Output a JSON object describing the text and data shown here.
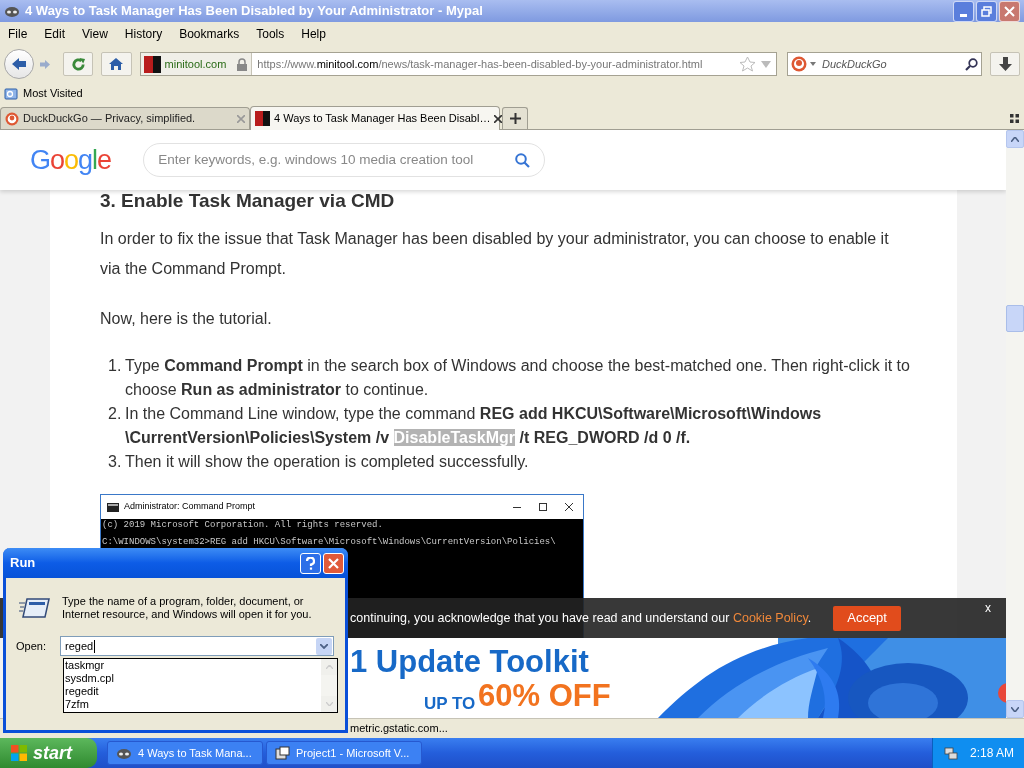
{
  "window": {
    "title": "4 Ways to Task Manager Has Been Disabled by Your Administrator - Mypal"
  },
  "menu": [
    "File",
    "Edit",
    "View",
    "History",
    "Bookmarks",
    "Tools",
    "Help"
  ],
  "navigation": {
    "site_identity": "minitool.com",
    "url": {
      "prefix": "https://www.",
      "domain": "minitool.com",
      "path": "/news/task-manager-has-been-disabled-by-your-administrator.html"
    },
    "search_placeholder": "DuckDuckGo"
  },
  "bookmarks": [
    "Most Visited"
  ],
  "tabs": [
    {
      "label": "DuckDuckGo — Privacy, simplified.",
      "selected": false
    },
    {
      "label": "4 Ways to Task Manager Has Been Disabl…",
      "selected": true
    }
  ],
  "page": {
    "header": {
      "logo": "Google",
      "search_placeholder": "Enter keywords, e.g. windows 10 media creation tool"
    },
    "article": {
      "heading": "3. Enable Task Manager via CMD",
      "paragraphs": [
        "In order to fix the issue that Task Manager has been disabled by your administrator, you can choose to enable it via the Command Prompt.",
        "Now, here is the tutorial."
      ],
      "steps": [
        {
          "number": "1.",
          "segments": [
            {
              "text": "Type ",
              "kind": "plain"
            },
            {
              "text": "Command Prompt",
              "kind": "bold"
            },
            {
              "text": " in the search box of Windows and choose the best-matched one. Then right-click it to choose ",
              "kind": "plain"
            },
            {
              "text": "Run as administrator",
              "kind": "bold"
            },
            {
              "text": " to continue.",
              "kind": "plain"
            }
          ]
        },
        {
          "number": "2.",
          "segments": [
            {
              "text": "In the Command Line window, type the command ",
              "kind": "plain"
            },
            {
              "text": "REG add HKCU\\Software\\Microsoft\\Windows",
              "kind": "bold"
            },
            {
              "text": "\\CurrentVersion\\Policies\\System /v ",
              "kind": "bold"
            },
            {
              "text": "DisableTaskMgr",
              "kind": "highlighted"
            },
            {
              "text": " /t REG_DWORD /d 0 /f.",
              "kind": "bold"
            }
          ]
        },
        {
          "number": "3.",
          "segments": [
            {
              "text": "Then it will show the operation is completed successfully.",
              "kind": "plain"
            }
          ]
        }
      ],
      "screenshot": {
        "title": "Administrator: Command Prompt",
        "lines": [
          "(c) 2019 Microsoft Corporation. All rights reserved.",
          "C:\\WINDOWS\\system32>REG add HKCU\\Software\\Microsoft\\Windows\\CurrentVersion\\Policies\\"
        ]
      }
    },
    "cookie_banner": {
      "text": "continuing, you acknowledge that you have read and understand our ",
      "link": "Cookie Policy",
      "after": ".",
      "button": "Accept",
      "close": "x"
    },
    "ad": {
      "headline": "1 Update Toolkit",
      "prefix": "UP TO",
      "offer": "60% OFF"
    }
  },
  "status_bar": "metric.gstatic.com...",
  "run_dialog": {
    "title": "Run",
    "description": "Type the name of a program, folder, document, or Internet resource, and Windows will open it for you.",
    "open_label": "Open:",
    "value": "reged",
    "suggestions": [
      "taskmgr",
      "sysdm.cpl",
      "regedit",
      "7zfm"
    ]
  },
  "taskbar": {
    "start": "start",
    "tasks": [
      {
        "label": "4 Ways to Task Mana...",
        "selected": false
      },
      {
        "label": "Project1 - Microsoft V...",
        "selected": false
      }
    ],
    "clock": "2:18 AM"
  }
}
